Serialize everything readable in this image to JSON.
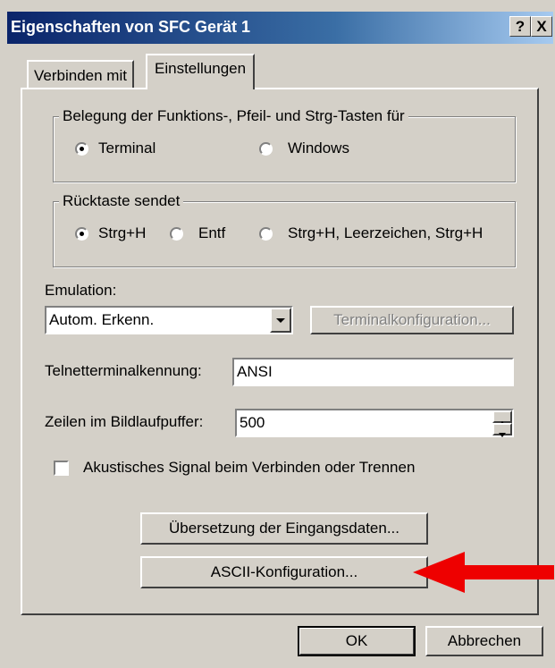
{
  "window": {
    "title": "Eigenschaften von SFC Gerät 1",
    "help_label": "?",
    "close_label": "X"
  },
  "tabs": [
    {
      "label": "Verbinden mit",
      "active": false
    },
    {
      "label": "Einstellungen",
      "active": true
    }
  ],
  "function_keys": {
    "legend": "Belegung der Funktions-, Pfeil- und Strg-Tasten für",
    "options": [
      {
        "label": "Terminal",
        "selected": true
      },
      {
        "label": "Windows",
        "selected": false
      }
    ]
  },
  "backspace": {
    "legend": "Rücktaste sendet",
    "options": [
      {
        "label": "Strg+H",
        "selected": true
      },
      {
        "label": "Entf",
        "selected": false
      },
      {
        "label": "Strg+H, Leerzeichen, Strg+H",
        "selected": false
      }
    ]
  },
  "emulation": {
    "label": "Emulation:",
    "value": "Autom. Erkenn.",
    "config_button": "Terminalkonfiguration..."
  },
  "telnet": {
    "label": "Telnetterminalkennung:",
    "value": "ANSI"
  },
  "scrollback": {
    "label": "Zeilen im Bildlaufpuffer:",
    "value": "500"
  },
  "beep": {
    "label": "Akustisches Signal beim Verbinden oder Trennen",
    "checked": false
  },
  "buttons": {
    "input_translation": "Übersetzung der Eingangsdaten...",
    "ascii_config": "ASCII-Konfiguration...",
    "ok": "OK",
    "cancel": "Abbrechen"
  },
  "colors": {
    "annotation_arrow": "#ee0000",
    "title_bar": "#0a246a"
  }
}
